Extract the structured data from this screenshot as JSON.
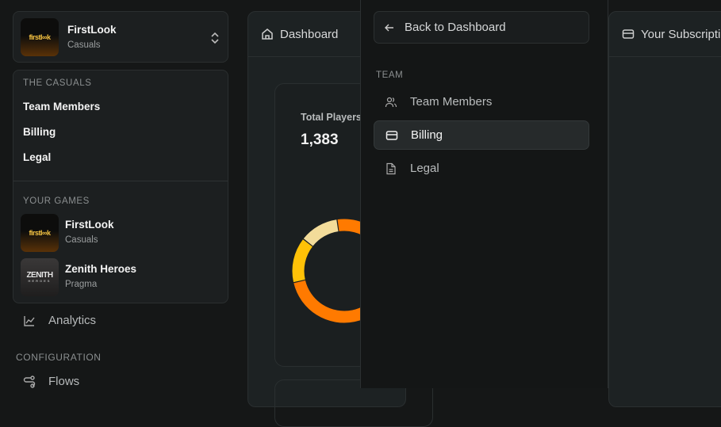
{
  "switcher": {
    "game": "FirstLook",
    "team": "Casuals",
    "logo_text": "firstlook"
  },
  "dropdown": {
    "team_section": "THE CASUALS",
    "team_items": [
      {
        "label": "Team Members"
      },
      {
        "label": "Billing"
      },
      {
        "label": "Legal"
      }
    ],
    "games_section": "YOUR GAMES",
    "games": [
      {
        "name": "FirstLook",
        "team": "Casuals",
        "logo_text": "firstlook"
      },
      {
        "name": "Zenith Heroes",
        "team": "Pragma",
        "logo_text": "ZENITH",
        "logo_sub": "HEROES"
      }
    ]
  },
  "sidebar": {
    "analytics": "Analytics",
    "config_section": "CONFIGURATION",
    "flows": "Flows"
  },
  "dashboard": {
    "title": "Dashboard",
    "card_title": "Total Players",
    "card_value": "1,383"
  },
  "overlay": {
    "back": "Back to Dashboard",
    "section": "TEAM",
    "items": [
      {
        "label": "Team Members",
        "active": false
      },
      {
        "label": "Billing",
        "active": true
      },
      {
        "label": "Legal",
        "active": false
      }
    ]
  },
  "subscription": {
    "title": "Your Subscription"
  },
  "chart_data": {
    "type": "pie",
    "title": "Total Players",
    "total": 1383,
    "values": [
      1018,
      196,
      169
    ],
    "colors": [
      "#ff7a00",
      "#ffc107",
      "#f3dc9a"
    ]
  }
}
